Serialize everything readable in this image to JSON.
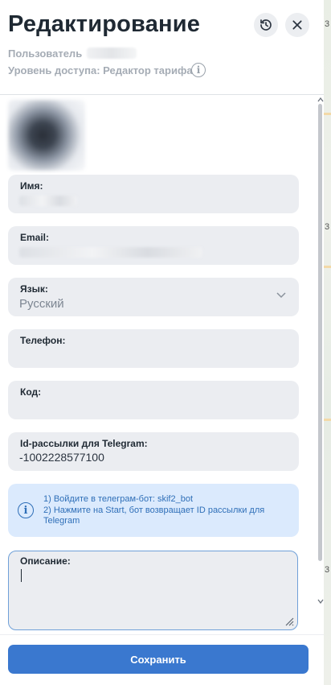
{
  "header": {
    "title": "Редактирование",
    "user_label": "Пользователь",
    "access_level": "Уровень доступа: Редактор тарифа"
  },
  "form": {
    "name": {
      "label": "Имя:"
    },
    "email": {
      "label": "Email:"
    },
    "language": {
      "label": "Язык:",
      "value": "Русский"
    },
    "phone": {
      "label": "Телефон:"
    },
    "code": {
      "label": "Код:"
    },
    "telegram": {
      "label": "Id-рассылки для Telegram:",
      "value": "-1002228577100"
    },
    "hint": {
      "line1": "1) Войдите в телеграм-бот: skif2_bot",
      "line2": "2) Нажмите на Start, бот возвращает ID рассылки для Telegram"
    },
    "description": {
      "label": "Описание:"
    }
  },
  "footer": {
    "save_label": "Сохранить"
  },
  "map": {
    "labels": [
      "3",
      "3",
      "3"
    ]
  },
  "colors": {
    "accent": "#3a78cf",
    "hint_bg": "#dbeafd",
    "field_bg": "#ebedf1"
  }
}
